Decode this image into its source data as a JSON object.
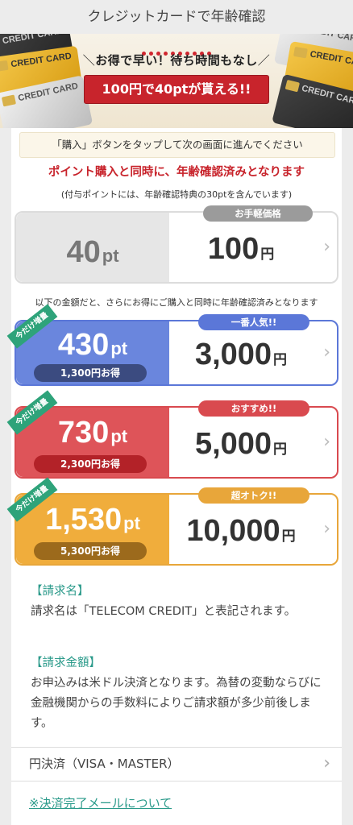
{
  "header": {
    "title": "クレジットカードで年齢確認"
  },
  "banner": {
    "card_text": "CREDIT CARD",
    "line1": "お得で早い！待ち時間もなし",
    "button": "100円で40ptが貰える!!"
  },
  "notice": "「購入」ボタンをタップして次の画面に進んでください",
  "headline": "ポイント購入と同時に、年齢確認済みとなります",
  "subnote": "(付与ポイントには、年齢確認特典の30ptを含んでいます)",
  "between_note": "以下の金額だと、さらにお得にご購入と同時に年齢確認済みとなります",
  "plans": [
    {
      "tag": "お手軽価格",
      "points": "40",
      "point_unit": "pt",
      "price": "100",
      "yen": "円",
      "save": "",
      "ribbon": ""
    },
    {
      "tag": "一番人気!!",
      "points": "430",
      "point_unit": "pt",
      "price": "3,000",
      "yen": "円",
      "save": "1,300円お得",
      "ribbon": "今だけ増量"
    },
    {
      "tag": "おすすめ!!",
      "points": "730",
      "point_unit": "pt",
      "price": "5,000",
      "yen": "円",
      "save": "2,300円お得",
      "ribbon": "今だけ増量"
    },
    {
      "tag": "超オトク!!",
      "points": "1,530",
      "point_unit": "pt",
      "price": "10,000",
      "yen": "円",
      "save": "5,300円お得",
      "ribbon": "今だけ増量"
    }
  ],
  "info": {
    "billing_name_heading": "【請求名】",
    "billing_name_text": "請求名は「TELECOM CREDIT」と表記されます。",
    "billing_amount_heading": "【請求金額】",
    "billing_amount_text": "お申込みは米ドル決済となります。為替の変動ならびに金融機関からの手数料によりご請求額が多少前後します。"
  },
  "pay_option": "円決済（VISA・MASTER）",
  "mail_link": "※決済完了メールについて",
  "colors": {
    "red": "#c8242c",
    "blue": "#5b77d8",
    "orange": "#e8a63a",
    "teal": "#2a9a8a"
  }
}
